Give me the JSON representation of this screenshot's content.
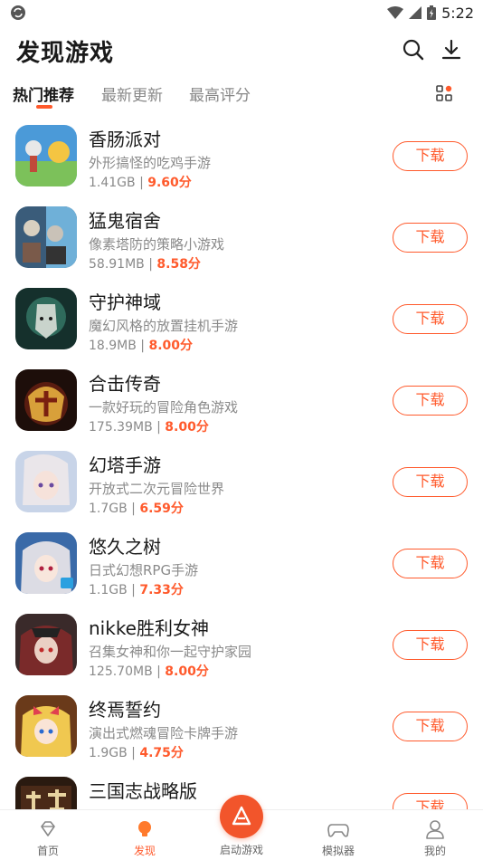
{
  "status_bar": {
    "time": "5:22"
  },
  "header": {
    "title": "发现游戏",
    "icons": [
      "search-icon",
      "download-icon"
    ]
  },
  "tabs": [
    {
      "label": "热门推荐",
      "active": true
    },
    {
      "label": "最新更新",
      "active": false
    },
    {
      "label": "最高评分",
      "active": false
    }
  ],
  "accent_color": "#ff5a2c",
  "games": [
    {
      "name": "香肠派对",
      "desc": "外形搞怪的吃鸡手游",
      "size": "1.41GB",
      "score": "9.60分",
      "button": "下载"
    },
    {
      "name": "猛鬼宿舍",
      "desc": "像素塔防的策略小游戏",
      "size": "58.91MB",
      "score": "8.58分",
      "button": "下载"
    },
    {
      "name": "守护神域",
      "desc": "魔幻风格的放置挂机手游",
      "size": "18.9MB",
      "score": "8.00分",
      "button": "下载"
    },
    {
      "name": "合击传奇",
      "desc": "一款好玩的冒险角色游戏",
      "size": "175.39MB",
      "score": "8.00分",
      "button": "下载"
    },
    {
      "name": "幻塔手游",
      "desc": "开放式二次元冒险世界",
      "size": "1.7GB",
      "score": "6.59分",
      "button": "下载"
    },
    {
      "name": "悠久之树",
      "desc": "日式幻想RPG手游",
      "size": "1.1GB",
      "score": "7.33分",
      "button": "下载"
    },
    {
      "name": "nikke胜利女神",
      "desc": "召集女神和你一起守护家园",
      "size": "125.70MB",
      "score": "8.00分",
      "button": "下载"
    },
    {
      "name": "终焉誓约",
      "desc": "演出式燃魂冒险卡牌手游",
      "size": "1.9GB",
      "score": "4.75分",
      "button": "下载"
    },
    {
      "name": "三国志战略版",
      "desc": "",
      "size": "",
      "score": "",
      "button": "下载"
    }
  ],
  "bottom_nav": {
    "home": "首页",
    "discover": "发现",
    "launch": "启动游戏",
    "emulator": "模拟器",
    "mine": "我的"
  }
}
